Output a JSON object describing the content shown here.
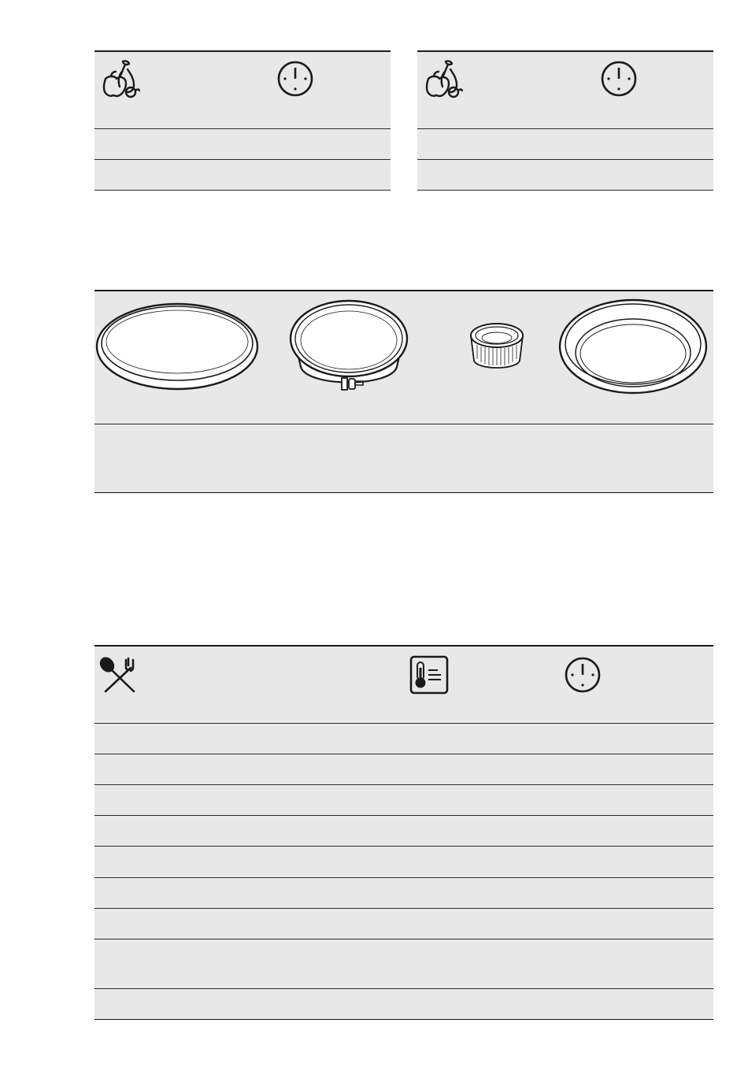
{
  "drying_table_left": {
    "header_icons": [
      "fruit-icon",
      "clock-icon"
    ],
    "rows": [
      {
        "food": "",
        "time": ""
      },
      {
        "food": "",
        "time": ""
      }
    ]
  },
  "drying_table_right": {
    "header_icons": [
      "fruit-icon",
      "clock-icon"
    ],
    "rows": [
      {
        "food": "",
        "time": ""
      },
      {
        "food": "",
        "time": ""
      }
    ]
  },
  "bakeware_table": {
    "images": [
      "flan-tin-icon",
      "springform-tin-icon",
      "ramekin-icon",
      "pie-dish-icon"
    ],
    "captions": [
      "",
      "",
      "",
      ""
    ]
  },
  "cooking_table": {
    "header_icons": [
      "cutlery-icon",
      "thermometer-icon",
      "clock-icon"
    ],
    "rows": [
      {
        "dish": "",
        "temperature": "",
        "time": ""
      },
      {
        "dish": "",
        "temperature": "",
        "time": ""
      },
      {
        "dish": "",
        "temperature": "",
        "time": ""
      },
      {
        "dish": "",
        "temperature": "",
        "time": ""
      },
      {
        "dish": "",
        "temperature": "",
        "time": ""
      },
      {
        "dish": "",
        "temperature": "",
        "time": ""
      },
      {
        "dish": "",
        "temperature": "",
        "time": ""
      },
      {
        "dish": "",
        "temperature": "",
        "time": ""
      },
      {
        "dish": "",
        "temperature": "",
        "time": ""
      }
    ]
  }
}
